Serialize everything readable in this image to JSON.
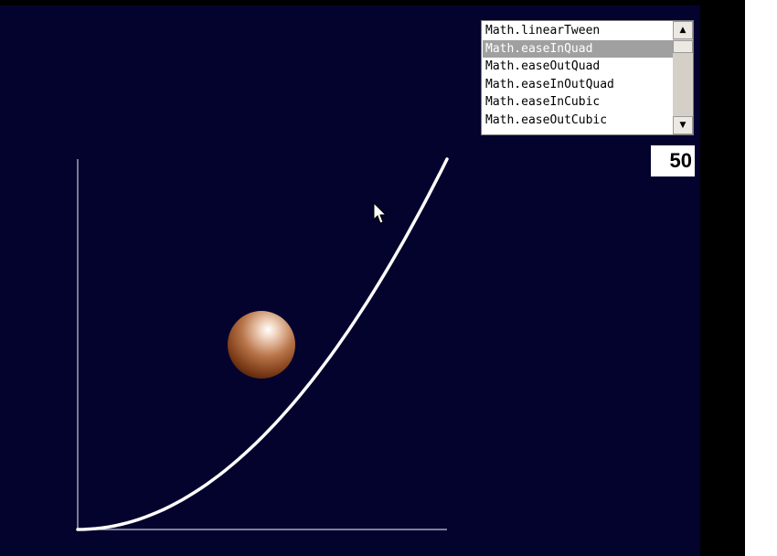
{
  "easing_list": {
    "items": [
      "Math.linearTween",
      "Math.easeInQuad",
      "Math.easeOutQuad",
      "Math.easeInOutQuad",
      "Math.easeInCubic",
      "Math.easeOutCubic"
    ],
    "selected": "Math.easeInQuad",
    "scroll_up_icon": "triangle-up",
    "scroll_down_icon": "triangle-down"
  },
  "frame_counter": {
    "value": "50"
  },
  "graph": {
    "curve": "easeInQuad",
    "progress": 0.5
  },
  "colors": {
    "stage_background": "#04032e",
    "curve": "#ffffff",
    "axis": "#c8c8d8",
    "selection": "#a0a0a0",
    "ball": "#b87448"
  },
  "cursor": {
    "icon": "arrow-pointer-icon"
  }
}
